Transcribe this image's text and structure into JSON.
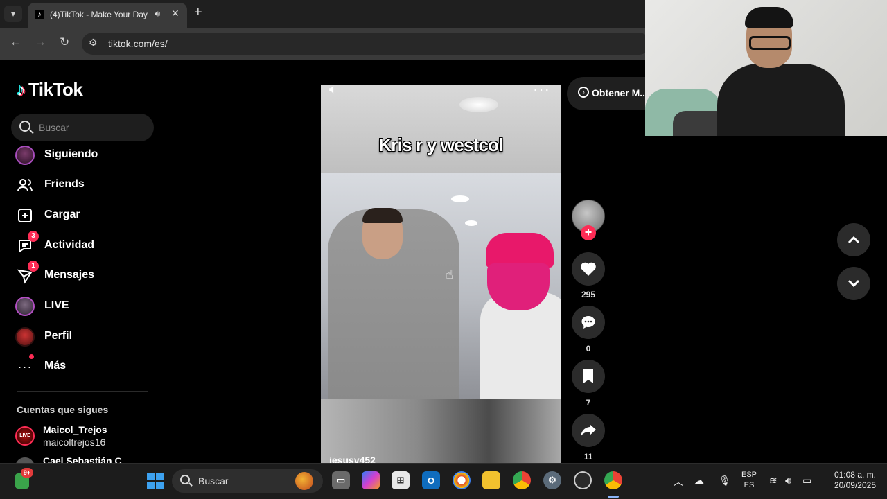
{
  "browser": {
    "tab": {
      "title": "(4)TikTok - Make Your Day",
      "favicon": "tiktok-icon"
    },
    "url": "tiktok.com/es/"
  },
  "tiktok": {
    "logo_text": "TikTok",
    "search_placeholder": "Buscar",
    "nav": [
      {
        "label": "Siguiendo",
        "icon": "following-avatar-icon"
      },
      {
        "label": "Friends",
        "icon": "friends-icon"
      },
      {
        "label": "Cargar",
        "icon": "upload-icon"
      },
      {
        "label": "Actividad",
        "icon": "activity-icon",
        "badge": "3"
      },
      {
        "label": "Mensajes",
        "icon": "messages-icon",
        "badge": "1"
      },
      {
        "label": "LIVE",
        "icon": "live-avatar-icon"
      },
      {
        "label": "Perfil",
        "icon": "profile-avatar-icon"
      },
      {
        "label": "Más",
        "icon": "more-icon",
        "dot": true
      }
    ],
    "following_section_title": "Cuentas que sigues",
    "following_accounts": [
      {
        "name": "Maicol_Trejos",
        "handle": "maicoltrejos16",
        "badge": "LIVE"
      },
      {
        "name": "Cael Sebastián C",
        "handle": ""
      }
    ],
    "video": {
      "caption": "Kris r y westcol",
      "author": "jesusy452"
    },
    "get_app_label": "Obtener M...",
    "actions": {
      "likes": "295",
      "comments": "0",
      "saves": "7",
      "shares": "11"
    }
  },
  "taskbar": {
    "widget_badge": "9+",
    "search_label": "Buscar",
    "language": {
      "line1": "ESP",
      "line2": "ES"
    },
    "time": "01:08 a. m.",
    "date": "20/09/2025"
  },
  "colors": {
    "tiktok_red": "#fe2c55",
    "tiktok_cyan": "#25f4ee",
    "chrome_tab_bg": "#3a3a3a",
    "page_bg": "#000000"
  }
}
